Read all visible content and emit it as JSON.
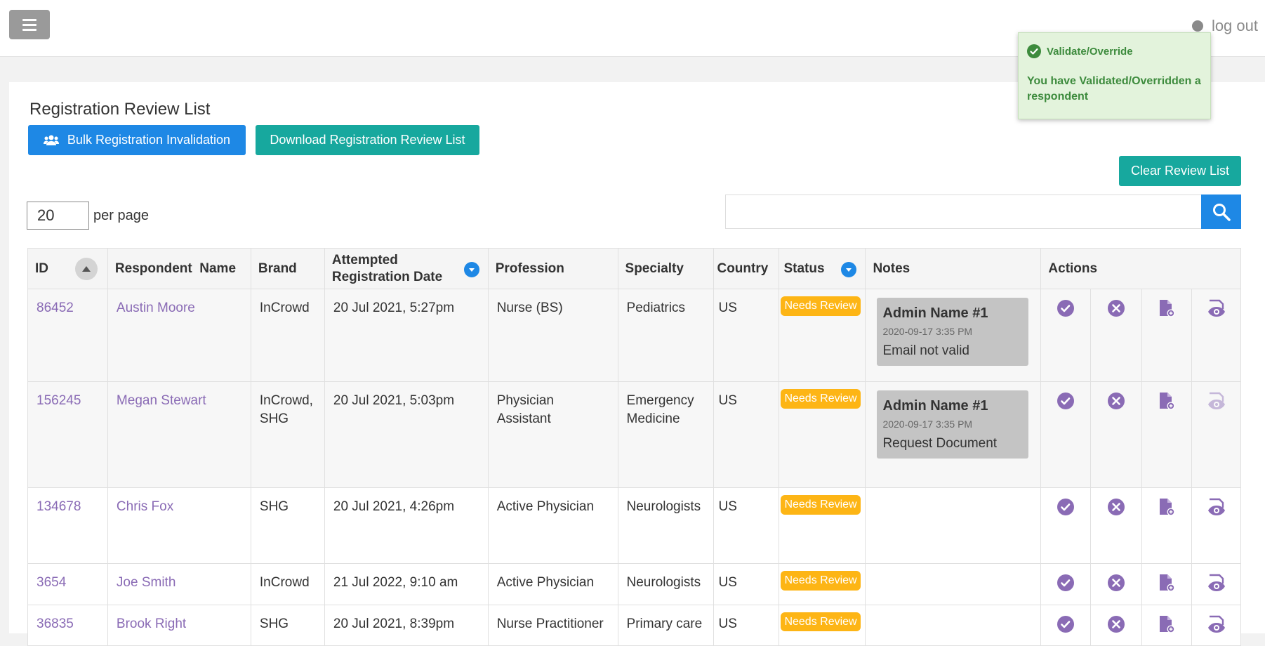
{
  "header": {
    "menu_icon": "hamburger-icon",
    "logout_label": "log out"
  },
  "toast": {
    "title": "Validate/Override",
    "message": "You have Validated/Overridden a respondent",
    "icon": "check-circle-icon",
    "color": "#3d8b3d",
    "background": "#e3f3dc"
  },
  "page": {
    "title": "Registration Review List",
    "bulk_button": "Bulk Registration Invalidation",
    "download_button": "Download Registration Review List",
    "clear_button": "Clear Review List",
    "per_page_value": "20",
    "per_page_label": "per page",
    "search_value": "",
    "accent_blue": "#1e88e5",
    "accent_teal": "#17a89e"
  },
  "table": {
    "columns": [
      "ID",
      "Respondent  Name",
      "Brand",
      "Attempted Registration Date",
      "Profession",
      "Specialty",
      "Country",
      "Status",
      "Notes",
      "Actions"
    ],
    "rows": [
      {
        "id": "86452",
        "name": "Austin Moore",
        "brand": "InCrowd",
        "date": "20 Jul 2021, 5:27pm",
        "profession": "Nurse (BS)",
        "specialty": "Pediatrics",
        "country": "US",
        "status": "Needs Review",
        "note_author": "Admin Name #1",
        "note_time": "2020-09-17 3:35 PM",
        "note_text": "Email not valid"
      },
      {
        "id": "156245",
        "name": "Megan Stewart",
        "brand": "InCrowd, SHG",
        "date": "20 Jul 2021, 5:03pm",
        "profession": "Physician Assistant",
        "specialty": "Emergency Medicine",
        "country": "US",
        "status": "Needs Review",
        "note_author": "Admin Name #1",
        "note_time": "2020-09-17 3:35 PM",
        "note_text": "Request Document"
      },
      {
        "id": "134678",
        "name": "Chris Fox",
        "brand": "SHG",
        "date": "20 Jul 2021, 4:26pm",
        "profession": "Active Physician",
        "specialty": "Neurologists",
        "country": "US",
        "status": "Needs Review"
      },
      {
        "id": "3654",
        "name": "Joe Smith",
        "brand": "InCrowd",
        "date": "21 Jul 2022, 9:10 am",
        "profession": "Active Physician",
        "specialty": "Neurologists",
        "country": "US",
        "status": "Needs Review"
      },
      {
        "id": "36835",
        "name": "Brook Right",
        "brand": "SHG",
        "date": "20 Jul 2021, 8:39pm",
        "profession": "Nurse Practitioner",
        "specialty": "Primary care",
        "country": "US",
        "status": "Needs Review"
      }
    ],
    "action_icons": [
      "validate-check-icon",
      "invalidate-x-icon",
      "add-document-icon",
      "view-eye-icon"
    ],
    "status_color": "#fdb515",
    "link_color": "#8a6bb5"
  }
}
